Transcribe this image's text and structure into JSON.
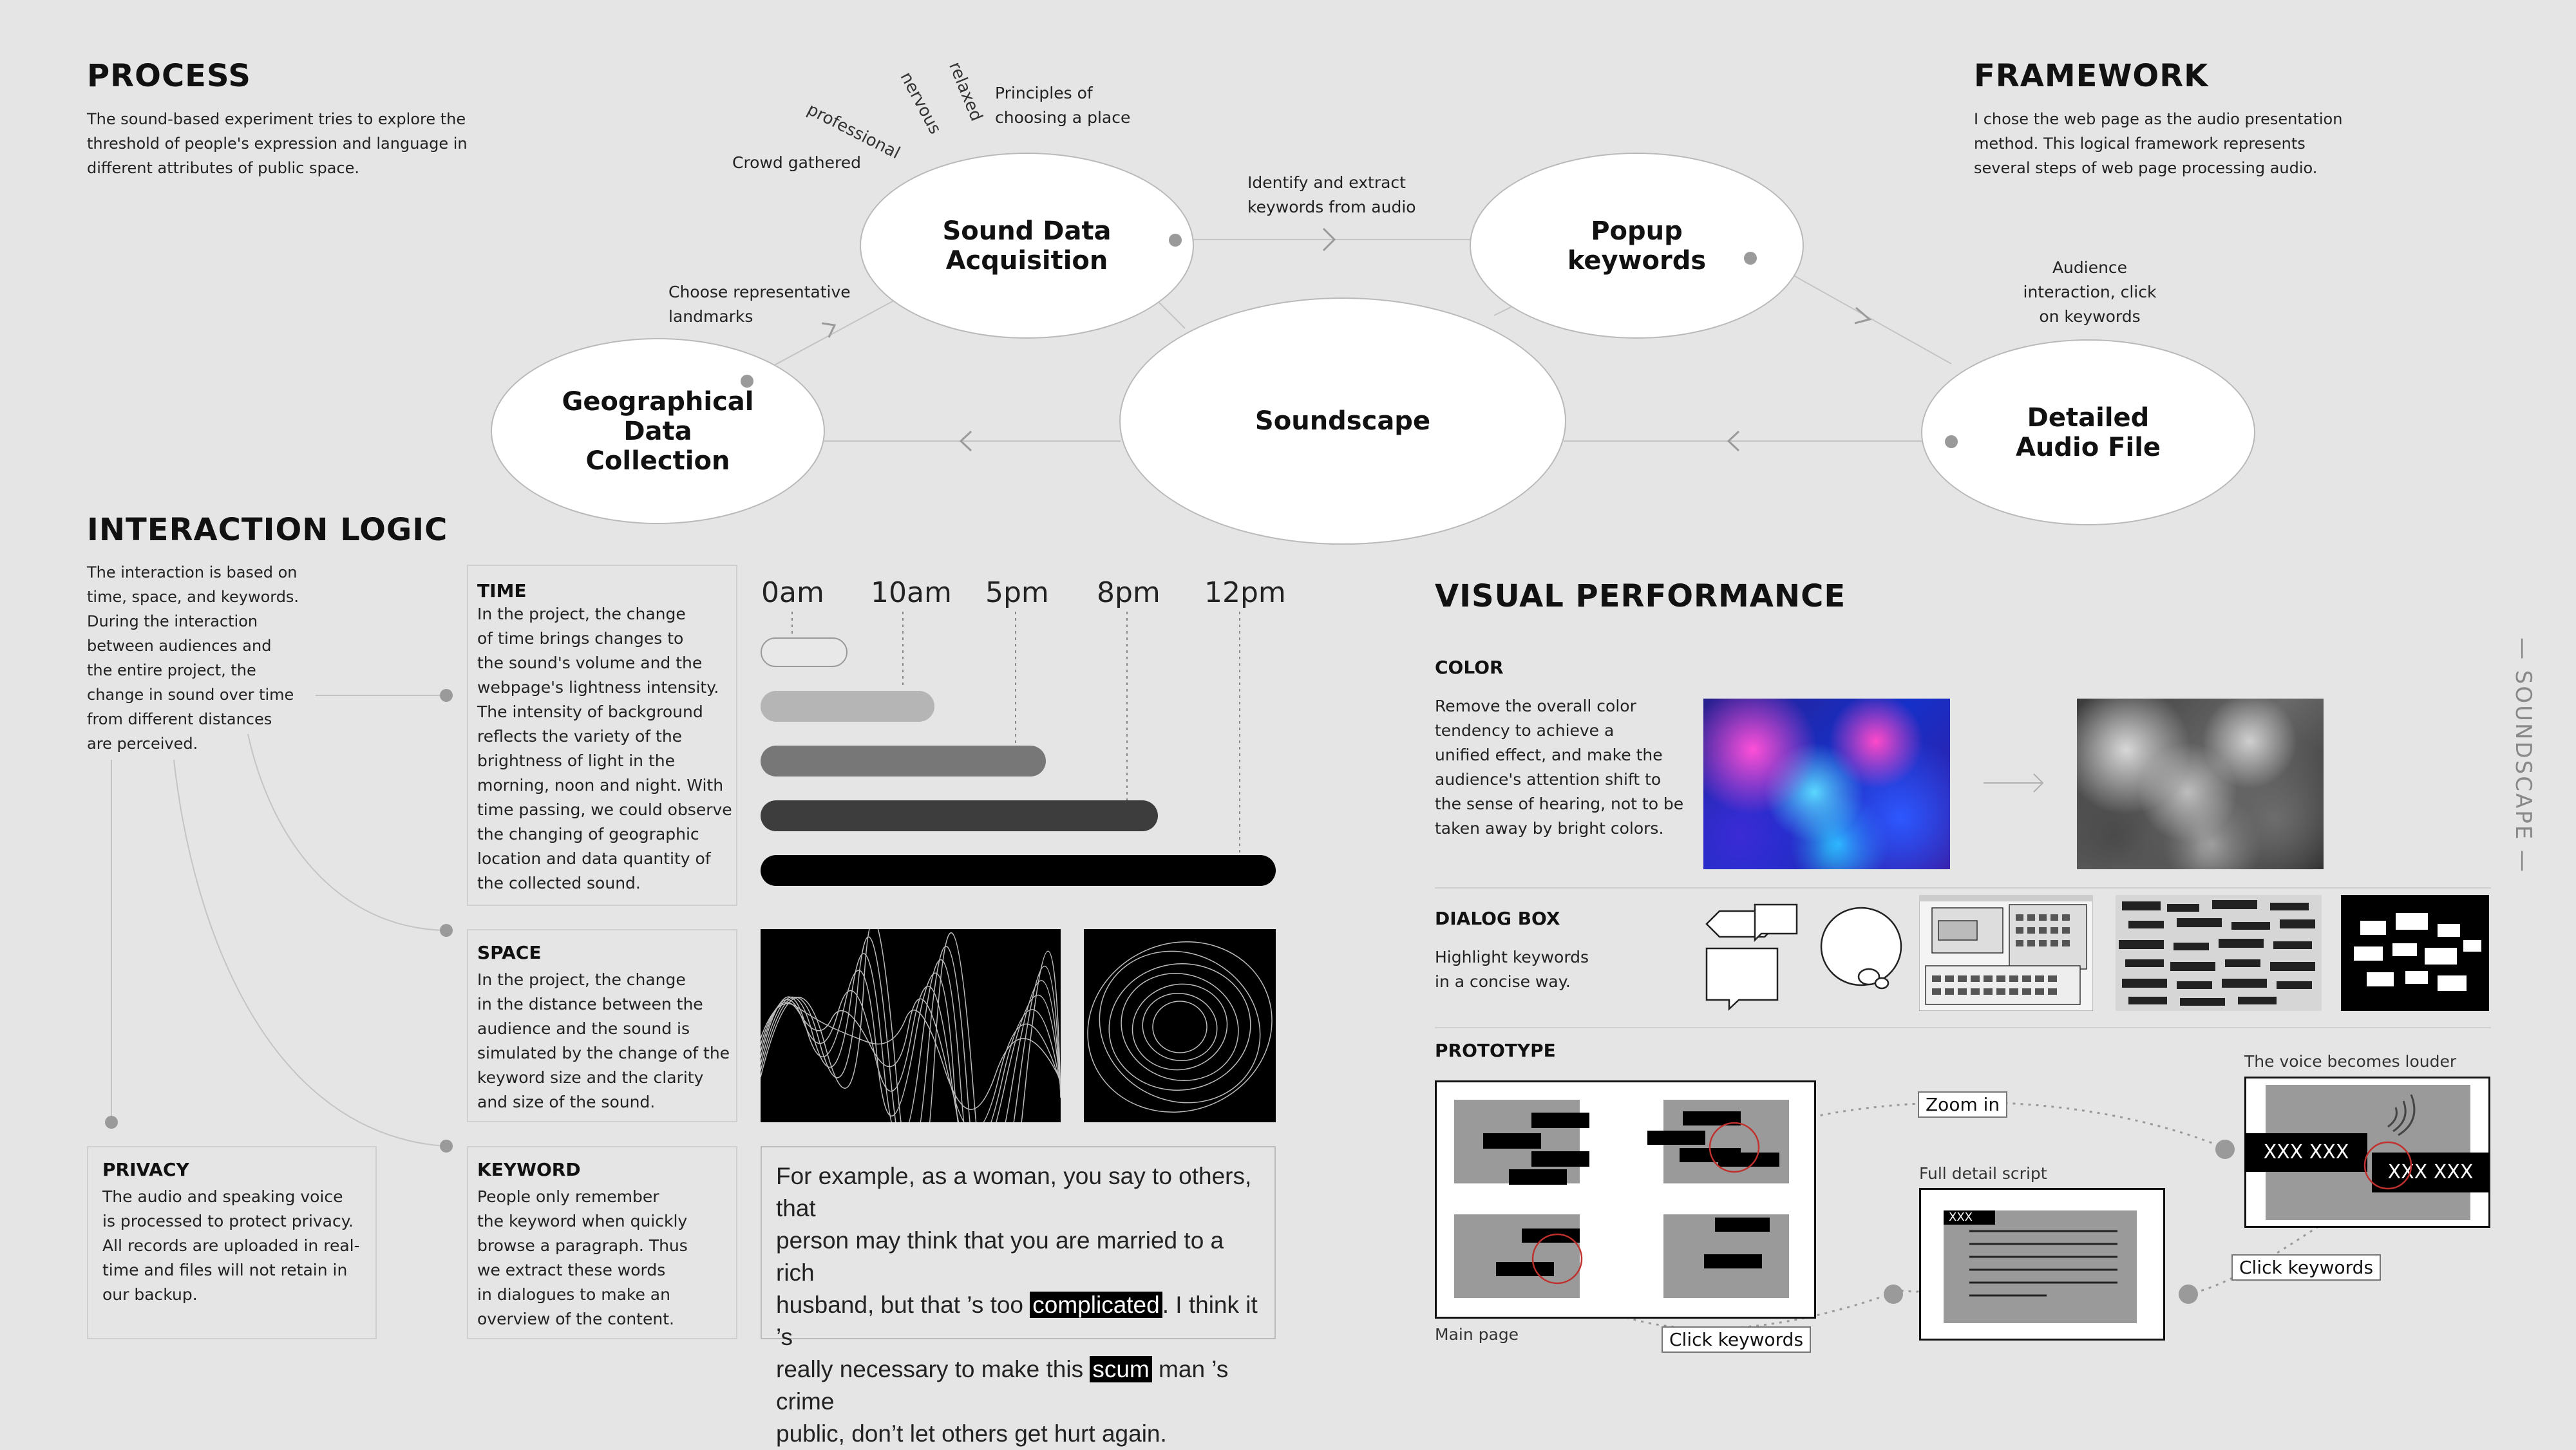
{
  "process": {
    "title": "PROCESS",
    "body_lines": [
      "The sound-based experiment tries to explore the",
      "threshold of people's expression and language in",
      "different attributes of public space."
    ]
  },
  "framework": {
    "title": "FRAMEWORK",
    "body_lines": [
      "I chose the web page as the audio presentation",
      "method. This logical framework represents",
      "several steps of web page processing audio."
    ]
  },
  "nodes": {
    "sound_data": [
      "Sound Data",
      "Acquisition"
    ],
    "popup": [
      "Popup",
      "keywords"
    ],
    "soundscape": "Soundscape",
    "geo": [
      "Geographical",
      "Data",
      "Collection"
    ],
    "detailed": [
      "Detailed",
      "Audio File"
    ]
  },
  "annotations": {
    "principles": [
      "Principles of",
      "choosing a place"
    ],
    "relaxed": "relaxed",
    "nervous": "nervous",
    "professional": "professional",
    "crowd": "Crowd gathered",
    "identify": [
      "Identify and extract",
      "keywords from audio"
    ],
    "choose": [
      "Choose representative",
      "landmarks"
    ],
    "audience": [
      "Audience",
      "interaction, click",
      "on keywords"
    ]
  },
  "interaction_logic": {
    "title": "INTERACTION LOGIC",
    "body_lines": [
      "The interaction is based on",
      "time, space, and keywords.",
      "During the interaction",
      "between audiences and",
      "the entire project, the",
      "change in sound over time",
      "from different distances",
      "are perceived."
    ]
  },
  "time": {
    "title": "TIME",
    "body_lines": [
      "In the project, the change",
      "of time brings changes to",
      "the sound's volume and the",
      "webpage's lightness intensity.",
      "The intensity of background",
      "reflects the variety of the",
      "brightness of light in the",
      "morning, noon and night. With",
      "time passing, we could observe",
      "the changing of geographic",
      "location and data quantity of",
      "the collected sound."
    ],
    "labels": [
      "0am",
      "10am",
      "5pm",
      "8pm",
      "12pm"
    ],
    "bar_colors": [
      "#e8e8e8",
      "#b5b5b5",
      "#777777",
      "#3d3d3d",
      "#000000"
    ]
  },
  "space": {
    "title": "SPACE",
    "body_lines": [
      "In the project, the change",
      "in the distance between the",
      "audience and the sound is",
      "simulated by the change of the",
      "keyword size and the clarity",
      "and size of the sound."
    ]
  },
  "keyword": {
    "title": "KEYWORD",
    "body_lines": [
      "People only remember",
      "the keyword when quickly",
      "browse a paragraph. Thus",
      "we extract these words",
      "in dialogues to make an",
      "overview of the content."
    ]
  },
  "privacy": {
    "title": "PRIVACY",
    "body_lines": [
      "The audio and speaking voice",
      "is processed to protect privacy.",
      "All records are uploaded in real-",
      "time and files will not retain in",
      "our backup."
    ]
  },
  "quote": {
    "line1": "For example, as a woman, you say to others, that",
    "line2": "person may think that you are married to a rich",
    "line3_a": "husband, but that ’s too ",
    "line3_hl": "complicated",
    "line3_b": ". I think it ’s",
    "line4_a": "really necessary to make this ",
    "line4_hl": "scum",
    "line4_b": " man ’s crime",
    "line5": "public, don’t let others get hurt again."
  },
  "visual": {
    "title": "VISUAL PERFORMANCE",
    "color_title": "COLOR",
    "color_lines": [
      "Remove the overall color",
      "tendency to achieve a",
      "unified effect, and make the",
      "audience's attention shift to",
      "the sense of hearing, not to be",
      "taken away by bright colors."
    ],
    "dialog_title": "DIALOG BOX",
    "dialog_lines": [
      "Highlight keywords",
      "in a concise way."
    ],
    "prototype_title": "PROTOTYPE"
  },
  "prototype": {
    "zoom_in": "Zoom in",
    "voice_louder": "The voice becomes louder",
    "full_detail": "Full detail script",
    "click_keywords_1": "Click keywords",
    "click_keywords_2": "Click keywords",
    "main_page": "Main page",
    "xxx_left": "XXX XXX",
    "xxx_right": "XXX XXX",
    "xxx_small": "XXX"
  },
  "side_label": "— SOUNDSCAPE —"
}
